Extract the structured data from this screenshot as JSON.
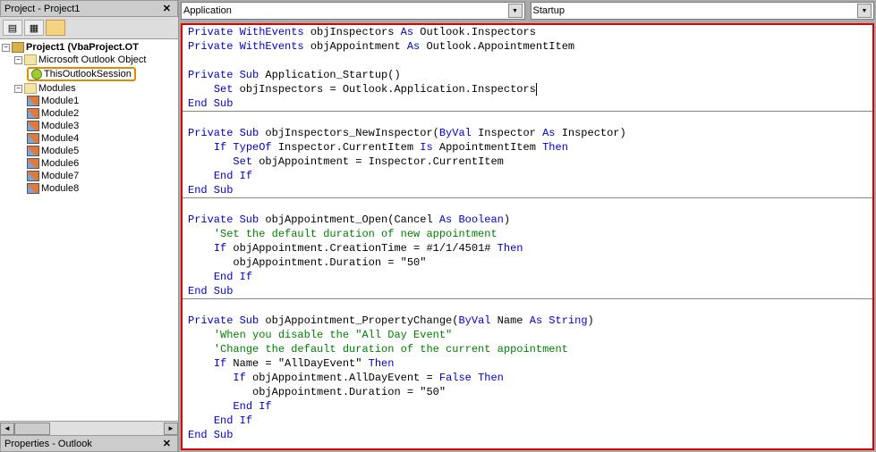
{
  "project_panel": {
    "title": "Project - Project1",
    "root": "Project1 (VbaProject.OT",
    "outlook_folder": "Microsoft Outlook Object",
    "session": "ThisOutlookSession",
    "modules_folder": "Modules",
    "modules": [
      "Module1",
      "Module2",
      "Module3",
      "Module4",
      "Module5",
      "Module6",
      "Module7",
      "Module8"
    ]
  },
  "properties_panel": {
    "title": "Properties - Outlook"
  },
  "dropdowns": {
    "left": "Application",
    "right": "Startup"
  },
  "code": {
    "l1a": "Private",
    "l1b": " WithEvents",
    "l1c": " objInspectors ",
    "l1d": "As",
    "l1e": " Outlook.Inspectors",
    "l2a": "Private",
    "l2b": " WithEvents",
    "l2c": " objAppointment ",
    "l2d": "As",
    "l2e": " Outlook.AppointmentItem",
    "l4a": "Private Sub",
    "l4b": " Application_Startup()",
    "l5a": "    ",
    "l5b": "Set",
    "l5c": " objInspectors = Outlook.Application.Inspectors",
    "l6": "End Sub",
    "l8a": "Private Sub",
    "l8b": " objInspectors_NewInspector(",
    "l8c": "ByVal",
    "l8d": " Inspector ",
    "l8e": "As",
    "l8f": " Inspector)",
    "l9a": "    ",
    "l9b": "If TypeOf",
    "l9c": " Inspector.CurrentItem ",
    "l9d": "Is",
    "l9e": " AppointmentItem ",
    "l9f": "Then",
    "l10a": "       ",
    "l10b": "Set",
    "l10c": " objAppointment = Inspector.CurrentItem",
    "l11a": "    ",
    "l11b": "End If",
    "l12": "End Sub",
    "l14a": "Private Sub",
    "l14b": " objAppointment_Open(Cancel ",
    "l14c": "As Boolean",
    "l14d": ")",
    "l15a": "    ",
    "l15b": "'Set the default duration of new appointment",
    "l16a": "    ",
    "l16b": "If",
    "l16c": " objAppointment.CreationTime = #1/1/4501# ",
    "l16d": "Then",
    "l17": "       objAppointment.Duration = \"50\"",
    "l18a": "    ",
    "l18b": "End If",
    "l19": "End Sub",
    "l21a": "Private Sub",
    "l21b": " objAppointment_PropertyChange(",
    "l21c": "ByVal",
    "l21d": " Name ",
    "l21e": "As String",
    "l21f": ")",
    "l22a": "    ",
    "l22b": "'When you disable the \"All Day Event\"",
    "l23a": "    ",
    "l23b": "'Change the default duration of the current appointment",
    "l24a": "    ",
    "l24b": "If",
    "l24c": " Name = \"AllDayEvent\" ",
    "l24d": "Then",
    "l25a": "       ",
    "l25b": "If",
    "l25c": " objAppointment.AllDayEvent = ",
    "l25d": "False Then",
    "l26": "          objAppointment.Duration = \"50\"",
    "l27a": "       ",
    "l27b": "End If",
    "l28a": "    ",
    "l28b": "End If",
    "l29": "End Sub"
  }
}
